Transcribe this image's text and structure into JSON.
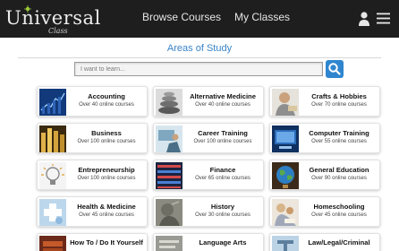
{
  "app": {
    "logo_text": "Universal",
    "logo_sub": "Class"
  },
  "nav": {
    "browse_label": "Browse Courses",
    "classes_label": "My Classes"
  },
  "page": {
    "title": "Areas of Study"
  },
  "search": {
    "placeholder": "I want to learn...",
    "value": ""
  },
  "colors": {
    "topbar": "#1e1e1e",
    "accent": "#3a84c8",
    "button": "#2f86cf"
  },
  "icons": [
    "user-icon",
    "menu-icon",
    "search-icon"
  ],
  "categories": [
    {
      "title": "Accounting",
      "subtitle": "Over 40 online courses"
    },
    {
      "title": "Alternative Medicine",
      "subtitle": "Over 40 online courses"
    },
    {
      "title": "Crafts & Hobbies",
      "subtitle": "Over 70 online courses"
    },
    {
      "title": "Business",
      "subtitle": "Over 100 online courses"
    },
    {
      "title": "Career Training",
      "subtitle": "Over 100 online courses"
    },
    {
      "title": "Computer Training",
      "subtitle": "Over 55 online courses"
    },
    {
      "title": "Entrepreneurship",
      "subtitle": "Over 100 online courses"
    },
    {
      "title": "Finance",
      "subtitle": "Over 65 online courses"
    },
    {
      "title": "General Education",
      "subtitle": "Over 90 online courses"
    },
    {
      "title": "Health & Medicine",
      "subtitle": "Over 45 online courses"
    },
    {
      "title": "History",
      "subtitle": "Over 30 online courses"
    },
    {
      "title": "Homeschooling",
      "subtitle": "Over 45 online courses"
    },
    {
      "title": "How To / Do It Yourself",
      "subtitle": ""
    },
    {
      "title": "Language Arts",
      "subtitle": ""
    },
    {
      "title": "Law/Legal/Criminal",
      "subtitle": ""
    }
  ]
}
